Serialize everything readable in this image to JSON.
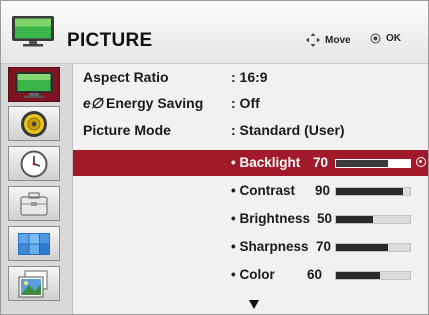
{
  "header": {
    "title": "PICTURE",
    "move_label": "Move",
    "ok_label": "OK"
  },
  "sidebar": {
    "items": [
      {
        "icon": "picture-tv-icon",
        "active": true
      },
      {
        "icon": "speaker-icon",
        "active": false
      },
      {
        "icon": "clock-icon",
        "active": false
      },
      {
        "icon": "toolbox-icon",
        "active": false
      },
      {
        "icon": "screen-grid-icon",
        "active": false
      },
      {
        "icon": "photo-media-icon",
        "active": false
      }
    ]
  },
  "settings": [
    {
      "label": "Aspect Ratio",
      "value": ": 16:9"
    },
    {
      "label": "Energy Saving",
      "eco_glyph": "e∅",
      "value": ": Off"
    },
    {
      "label": "Picture Mode",
      "value": ": Standard (User)"
    }
  ],
  "adjustments": [
    {
      "label": "• Backlight",
      "value": "70",
      "level": 70,
      "selected": true
    },
    {
      "label": "• Contrast",
      "value": "90",
      "level": 90,
      "selected": false
    },
    {
      "label": "• Brightness",
      "value": "50",
      "level": 50,
      "selected": false
    },
    {
      "label": "• Sharpness",
      "value": "70",
      "level": 70,
      "selected": false
    },
    {
      "label": "• Color",
      "value": "60",
      "level": 60,
      "selected": false
    }
  ],
  "colors": {
    "highlight": "#a01a2a",
    "active_sidebar": "#7d1420"
  }
}
